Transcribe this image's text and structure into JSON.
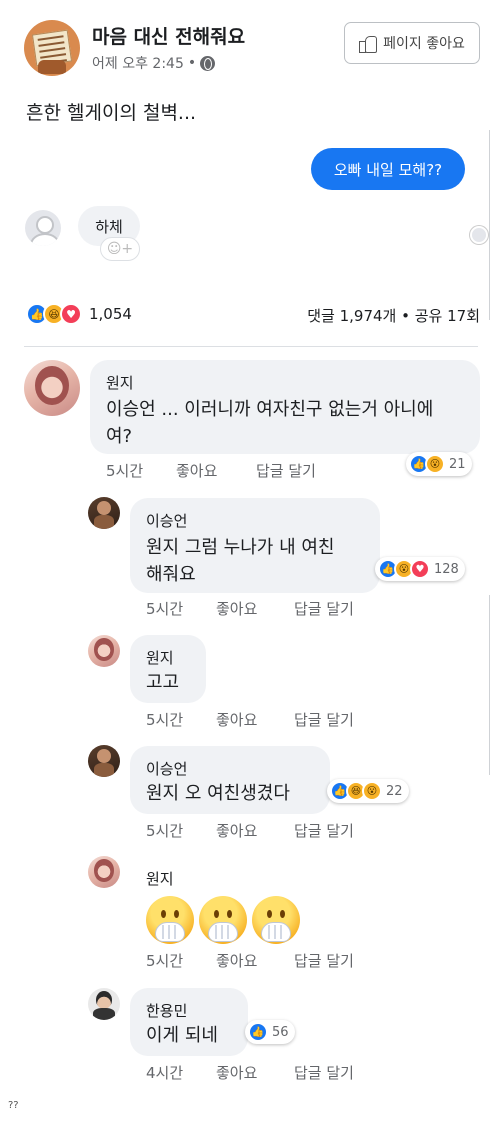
{
  "post": {
    "page_name": "마음 대신 전해줘요",
    "time": "어제 오후 2:45",
    "separator": "•",
    "like_page_label": "페이지 좋아요",
    "text": "흔한 헬게이의 철벽...",
    "messenger": {
      "sent_message": "오빠 내일 모해??",
      "reply_message": "하체"
    },
    "reaction_count": "1,054",
    "stats": "댓글 1,974개 • 공유 17회"
  },
  "comments": [
    {
      "author": "원지",
      "text": "이승언 ... 이러니까 여자친구 없는거 아니에여?",
      "time": "5시간",
      "like_label": "좋아요",
      "reply_label": "답글 달기",
      "reactions_count": "21",
      "reactions": [
        "like-icon",
        "wow-icon"
      ]
    },
    {
      "author": "이승언",
      "text": "원지 그럼 누나가 내 여친해줘요",
      "time": "5시간",
      "like_label": "좋아요",
      "reply_label": "답글 달기",
      "reactions_count": "128",
      "reactions": [
        "like-icon",
        "wow-icon",
        "love-icon"
      ]
    },
    {
      "author": "원지",
      "text": "고고",
      "time": "5시간",
      "like_label": "좋아요",
      "reply_label": "답글 달기"
    },
    {
      "author": "이승언",
      "text": "원지 오 여친생겼다",
      "time": "5시간",
      "like_label": "좋아요",
      "reply_label": "답글 달기",
      "reactions_count": "22",
      "reactions": [
        "like-icon",
        "haha-icon",
        "wow-icon"
      ]
    },
    {
      "author": "원지",
      "text": "",
      "emojis": [
        "face-with-hand-over-mouth-icon",
        "face-with-hand-over-mouth-icon",
        "face-with-hand-over-mouth-icon"
      ],
      "time": "5시간",
      "like_label": "좋아요",
      "reply_label": "답글 달기"
    },
    {
      "author": "한용민",
      "text": "이게 되네",
      "time": "4시간",
      "like_label": "좋아요",
      "reply_label": "답글 달기",
      "reactions_count": "56",
      "reactions": [
        "like-icon"
      ]
    }
  ],
  "footnote": "??",
  "colors": {
    "facebook_blue": "#1877f2",
    "bubble_gray": "#f0f2f5",
    "meta_gray": "#65676b"
  }
}
